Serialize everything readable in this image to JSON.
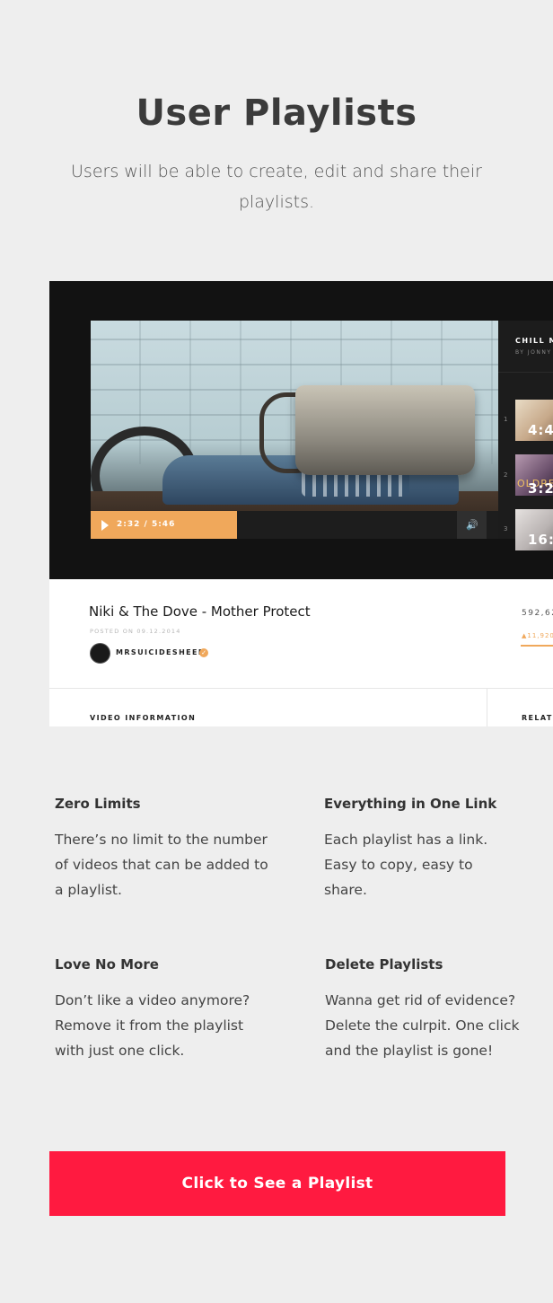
{
  "heading": {
    "title": "User Playlists",
    "subtitle": "Users will be able to create, edit and share their playlists."
  },
  "mockup": {
    "player": {
      "time": "2:32 / 5:46",
      "progress": 0.36
    },
    "playlist": {
      "title": "CHILL M",
      "author": "BY JONNY",
      "items": [
        {
          "number": "1",
          "duration": "4:4"
        },
        {
          "number": "2",
          "duration": "3:2",
          "overlay": "OLDRE"
        },
        {
          "number": "3",
          "duration": "16:2"
        }
      ]
    },
    "video": {
      "title": "Niki & The Dove - Mother Protect",
      "posted": "POSTED ON 09.12.2014",
      "channel": "MRSUICIDESHEEP",
      "views": "592,62",
      "likes": "11,920"
    },
    "sections": {
      "video_information": "VIDEO INFORMATION",
      "related": "RELATE"
    }
  },
  "features": [
    {
      "title": "Zero Limits",
      "body": "There’s no limit to the number of videos that can be added to a playlist."
    },
    {
      "title": "Everything in One Link",
      "body": "Each playlist has a link. Easy to copy, easy to share."
    },
    {
      "title": "Love No More",
      "body": "Don’t like a video anymore? Remove it from the playlist with just one click."
    },
    {
      "title": "Delete Playlists",
      "body": "Wanna get rid of evidence? Delete the culrpit. One click and the playlist is gone!"
    }
  ],
  "cta": {
    "label": "Click to See a Playlist"
  },
  "colors": {
    "accent": "#ff1a40",
    "progress": "#f0a85b",
    "background": "#eeeeee"
  }
}
